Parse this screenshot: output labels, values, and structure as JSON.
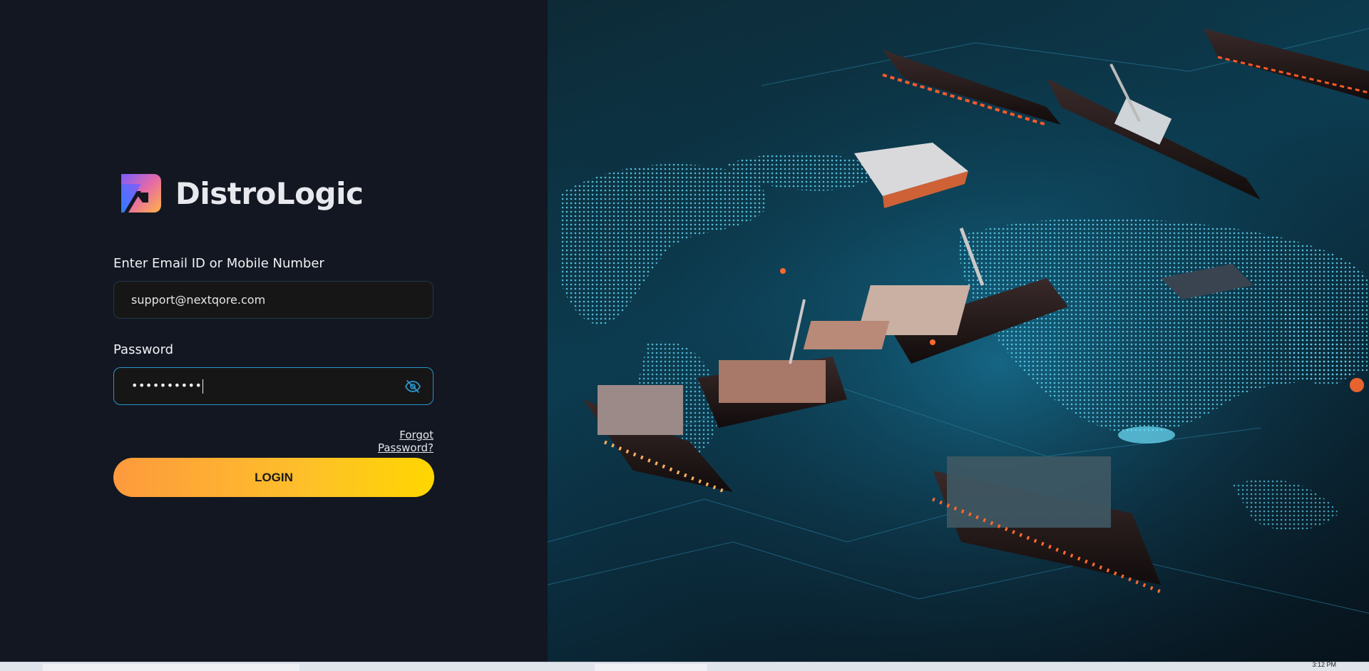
{
  "brand": {
    "name": "DistroLogic",
    "logo_icon": "distrologic-logo-icon"
  },
  "login_form": {
    "email_label": "Enter Email ID or Mobile Number",
    "email_value": "support@nextqore.com",
    "password_label": "Password",
    "password_masked": "••••••••••",
    "password_toggle_icon": "eye-off-icon",
    "forgot_password": "Forgot Password?",
    "login_button": "LOGIN"
  },
  "hero_image": {
    "subject": "cargo-ships-world-map-illustration"
  },
  "taskbar": {
    "clock": "3:12 PM"
  },
  "colors": {
    "background": "#131722",
    "input_background": "#161616",
    "focus_border": "#2a93c9",
    "button_gradient_start": "#fd9a3d",
    "button_gradient_end": "#ffd600"
  }
}
